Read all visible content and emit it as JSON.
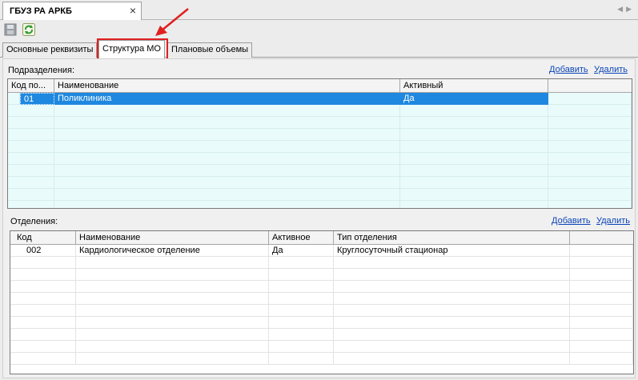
{
  "document_tab": {
    "title": "ГБУЗ РА АРКБ",
    "close": "×"
  },
  "nav": {
    "left": "◀",
    "right": "▶"
  },
  "toolbar": {
    "save_icon": "save-icon",
    "refresh_icon": "refresh-icon"
  },
  "tabs": [
    {
      "label": "Основные реквизиты",
      "active": false
    },
    {
      "label": "Структура МО",
      "active": true
    },
    {
      "label": "Плановые объемы",
      "active": false
    }
  ],
  "subdivisions": {
    "label": "Подразделения:",
    "add": "Добавить",
    "delete": "Удалить",
    "columns": [
      "Код по...",
      "Наименование",
      "Активный"
    ],
    "rows": [
      {
        "code": "01",
        "name": "Поликлиника",
        "active": "Да",
        "selected": true
      }
    ]
  },
  "departments": {
    "label": "Отделения:",
    "add": "Добавить",
    "delete": "Удалить",
    "columns": [
      "Код",
      "Наименование",
      "Активное",
      "Тип отделения"
    ],
    "rows": [
      {
        "code": "002",
        "name": "Кардиологическое отделение",
        "active": "Да",
        "type": "Круглосуточный стационар"
      }
    ]
  },
  "colors": {
    "accent": "#1e88e0",
    "annotation": "#e02020",
    "link": "#0b44b8"
  }
}
